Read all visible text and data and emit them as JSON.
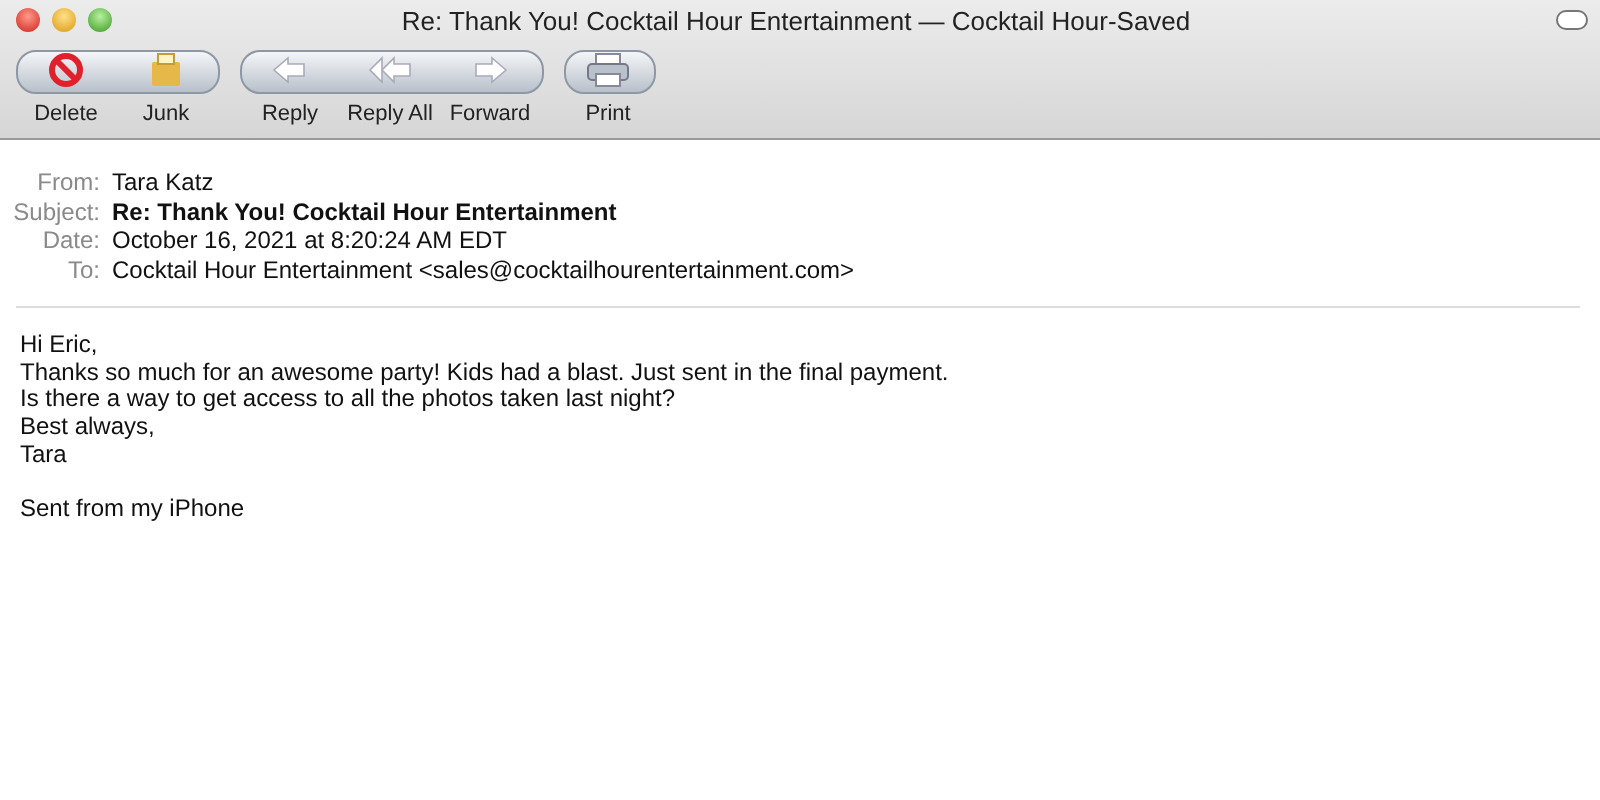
{
  "window": {
    "title": "Re: Thank You! Cocktail Hour Entertainment — Cocktail Hour-Saved"
  },
  "toolbar": {
    "groups": [
      [
        {
          "kind": "delete",
          "label": "Delete"
        },
        {
          "kind": "junk",
          "label": "Junk"
        }
      ],
      [
        {
          "kind": "reply",
          "label": "Reply"
        },
        {
          "kind": "reply_all",
          "label": "Reply All"
        },
        {
          "kind": "forward",
          "label": "Forward"
        }
      ],
      [
        {
          "kind": "print",
          "label": "Print"
        }
      ]
    ]
  },
  "headers": [
    {
      "label": "From:",
      "value": "Tara Katz",
      "emphasis": false
    },
    {
      "label": "Subject:",
      "value": "Re: Thank You! Cocktail Hour Entertainment",
      "emphasis": true
    },
    {
      "label": "Date:",
      "value": "October 16, 2021 at 8:20:24 AM EDT",
      "emphasis": false
    },
    {
      "label": "To:",
      "value": "Cocktail Hour Entertainment <sales@cocktailhourentertainment.com>",
      "emphasis": false
    }
  ],
  "body": [
    [
      "Hi Eric,",
      "Thanks so much for an awesome party! Kids had a blast. Just sent in the final payment.",
      "Is there a way to get access to all the photos taken last night?",
      "Best always,",
      "Tara"
    ],
    [
      "Sent from my iPhone"
    ]
  ]
}
